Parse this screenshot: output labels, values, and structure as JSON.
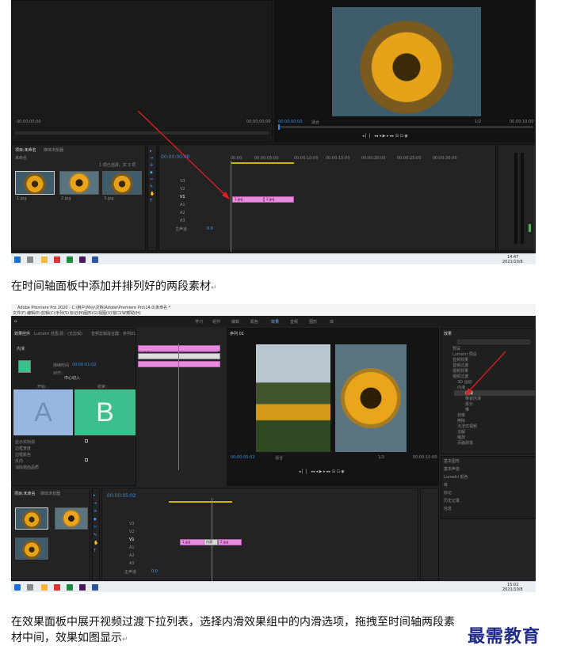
{
  "shot1": {
    "left_panel_tabs": [
      "项目:未命名",
      "媒体浏览器"
    ],
    "project_name": "未命名",
    "project_info": "1 项已选择，共 3 项",
    "thumbs": [
      "1.jpg",
      "2.jpg",
      "3.jpg"
    ],
    "source_timecode": "00;00;00;00",
    "source_end": "00;00;00;00",
    "program_timecode": "00:00:00:00",
    "program_fit": "适合",
    "program_scale": "1/2",
    "program_end": "00:00:10:00",
    "timeline_timecode": "00:00:00:00",
    "ruler_marks": [
      "00:00",
      "00:00:05:00",
      "00:00:10:00",
      "00:00:15:00",
      "00:00:20:00",
      "00:00:25:00",
      "00:00:30:00"
    ],
    "tracks": [
      "V3",
      "V2",
      "V1",
      "A1",
      "A2",
      "A3",
      "主声道"
    ],
    "master_value": "0.0",
    "clips": [
      "1.jpg",
      "2.jpg"
    ],
    "taskbar_time": "14:47",
    "taskbar_date": "2021/10/8"
  },
  "caption1": "在时间轴面板中添加并排列好的两段素材",
  "shot2": {
    "title": "Adobe Premiere Pro 2020 - C:\\用户\\Msy\\文档\\Adobe\\Premiere Pro\\14.0\\未命名 *",
    "menu": [
      "文件(F)",
      "编辑(E)",
      "剪辑(C)",
      "序列(S)",
      "标记(M)",
      "图形(G)",
      "视图(V)",
      "窗口(W)",
      "帮助(H)"
    ],
    "workspaces": [
      "学习",
      "组件",
      "编辑",
      "颜色",
      "效果",
      "音频",
      "图形",
      "库"
    ],
    "effect_controls_tabs": [
      "效果控件",
      "Lumetri 范围",
      "源：(无剪辑)",
      "音频剪辑混合器：序列01"
    ],
    "transition_name": "内滑",
    "duration_label": "持续时间",
    "duration_value": "00:00:01:02",
    "alignment_label": "对齐：",
    "alignment_value": "中心切入",
    "start_label": "开始：",
    "end_label": "结束：",
    "a_label": "A",
    "b_label": "B",
    "options": [
      "显示实际源",
      "边框宽度",
      "边框颜色",
      "反向",
      "消除锯齿品质"
    ],
    "sequence_tab": "序列 01",
    "program_timecode": "00:00:05:02",
    "program_fit": "适合",
    "program_scale": "1/2",
    "program_end": "00:00:10:00",
    "effects_title": "效果",
    "effects_tree": [
      "预设",
      "Lumetri 预设",
      "音频效果",
      "音频过渡",
      "视频效果",
      "视频过渡",
      "3D 运动",
      "内滑",
      "内滑",
      "带状内滑",
      "拆分",
      "推",
      "划像",
      "擦除",
      "沉浸式视频",
      "溶解",
      "缩放",
      "页面剥落"
    ],
    "side_panels": [
      "基本图形",
      "基本声音",
      "Lumetri 颜色",
      "库",
      "标记",
      "历史记录",
      "信息"
    ],
    "project_tabs": [
      "项目:未命名",
      "媒体浏览器"
    ],
    "timeline_timecode": "00:00:05:02",
    "tracks": [
      "V3",
      "V2",
      "V1",
      "A1",
      "A2",
      "A3",
      "主声道"
    ],
    "master_value": "0.0",
    "clips": [
      "1.jpg",
      "2.jpg"
    ],
    "transition_clip": "内滑",
    "taskbar_time": "15:02",
    "taskbar_date": "2021/10/8"
  },
  "caption2_line1": "在效果面板中展开视频过渡下拉列表，选择内滑效果组中的内滑选项，拖拽至时间轴两段素",
  "caption2_line2": "材中间，效果如图显示",
  "watermark": "最需教育",
  "colors": {
    "clip": "#e88ce0",
    "timecode": "#2d8ceb",
    "arrow": "#e0201f",
    "watermark": "#1f2a8a"
  }
}
